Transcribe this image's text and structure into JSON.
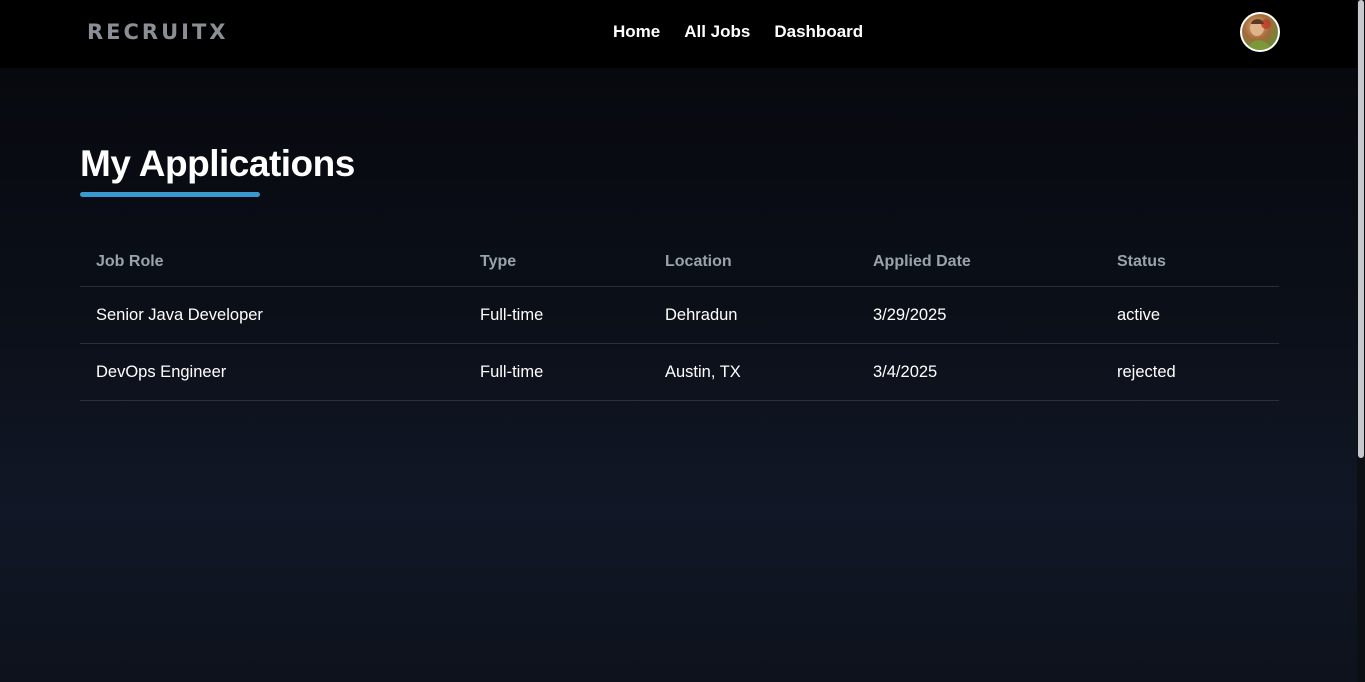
{
  "navbar": {
    "logo": "RECRUITX",
    "links": [
      "Home",
      "All Jobs",
      "Dashboard"
    ]
  },
  "page": {
    "title": "My Applications",
    "accent_color": "#3a9ad0"
  },
  "table": {
    "headers": [
      "Job Role",
      "Type",
      "Location",
      "Applied Date",
      "Status"
    ],
    "rows": [
      [
        "Senior Java Developer",
        "Full-time",
        "Dehradun",
        "3/29/2025",
        "active"
      ],
      [
        "DevOps Engineer",
        "Full-time",
        "Austin, TX",
        "3/4/2025",
        "rejected"
      ]
    ]
  }
}
